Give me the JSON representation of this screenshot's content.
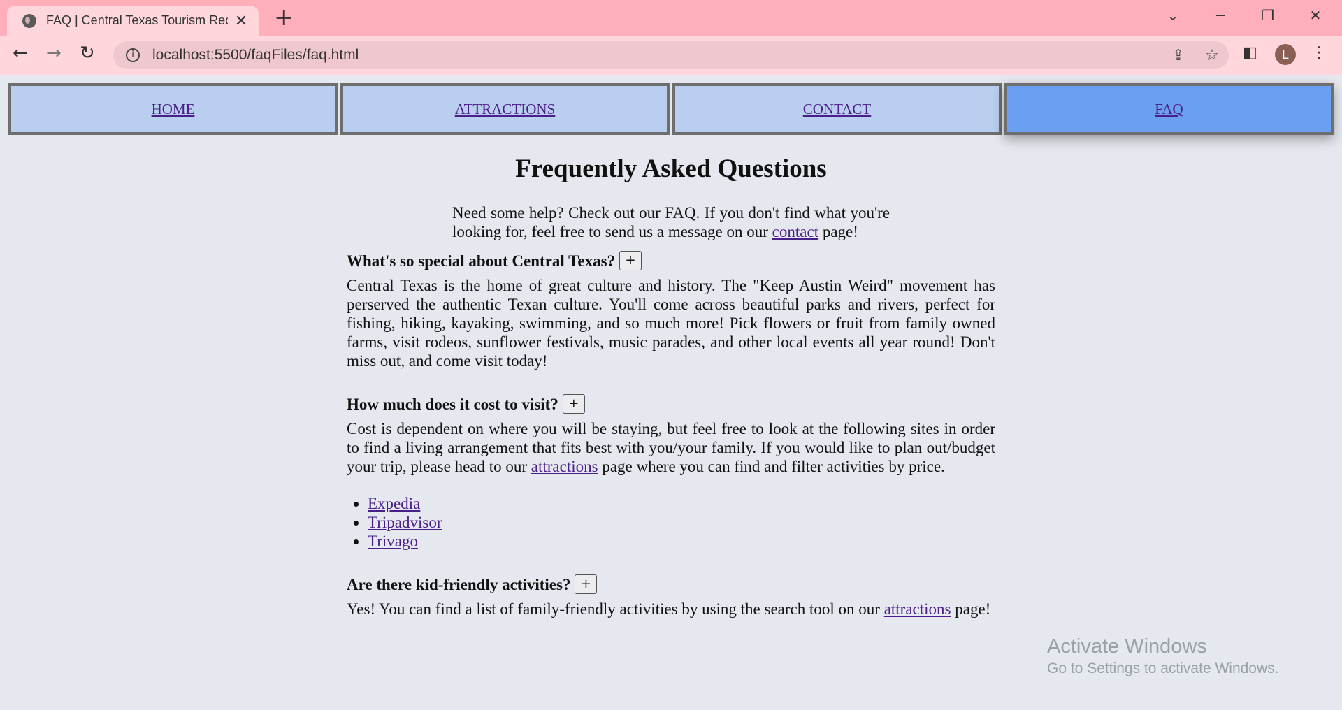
{
  "browser": {
    "tab_title": "FAQ | Central Texas Tourism Reco",
    "tab_close": "✕",
    "new_tab": "+",
    "url": "localhost:5500/faqFiles/faq.html",
    "profile_initial": "L",
    "icons": {
      "minimize": "─",
      "restore": "❐",
      "close": "✕",
      "tab_search": "⌄",
      "back": "←",
      "forward": "→",
      "reload": "↻",
      "share": "⇪",
      "star": "☆",
      "sidebar": "◧",
      "menu": "⋮",
      "info": "i"
    }
  },
  "nav": {
    "items": [
      {
        "label": "HOME"
      },
      {
        "label": "ATTRACTIONS"
      },
      {
        "label": "CONTACT"
      },
      {
        "label": "FAQ",
        "active": true
      }
    ]
  },
  "page": {
    "title": "Frequently Asked Questions",
    "intro_before": "Need some help? Check out our FAQ. If you don't find what you're looking for, feel free to send us a message on our ",
    "intro_link": "contact",
    "intro_after": " page!",
    "faqs": [
      {
        "question": "What's so special about Central Texas?",
        "toggle": "+",
        "answer": "Central Texas is the home of great culture and history. The \"Keep Austin Weird\" movement has perserved the authentic Texan culture. You'll come across beautiful parks and rivers, perfect for fishing, hiking, kayaking, swimming, and so much more! Pick flowers or fruit from family owned farms, visit rodeos, sunflower festivals, music parades, and other local events all year round! Don't miss out, and come visit today!"
      },
      {
        "question": "How much does it cost to visit?",
        "toggle": "+",
        "answer_before": "Cost is dependent on where you will be staying, but feel free to look at the following sites in order to find a living arrangement that fits best with you/your family. If you would like to plan out/budget your trip, please head to our ",
        "answer_link": "attractions",
        "answer_after": " page where you can find and filter activities by price.",
        "links": [
          "Expedia",
          "Tripadvisor",
          "Trivago"
        ]
      },
      {
        "question": "Are there kid-friendly activities?",
        "toggle": "+",
        "answer_before": "Yes! You can find a list of family-friendly activities by using the search tool on our ",
        "answer_link": "attractions",
        "answer_after": " page!"
      }
    ]
  },
  "watermark": {
    "line1": "Activate Windows",
    "line2": "Go to Settings to activate Windows."
  },
  "colors": {
    "chrome": "#ffafbb",
    "nav_bg": "#bacfef",
    "nav_active": "#6aa0ef",
    "page_bg": "#e6e8ef",
    "link": "#4b1f8a"
  }
}
